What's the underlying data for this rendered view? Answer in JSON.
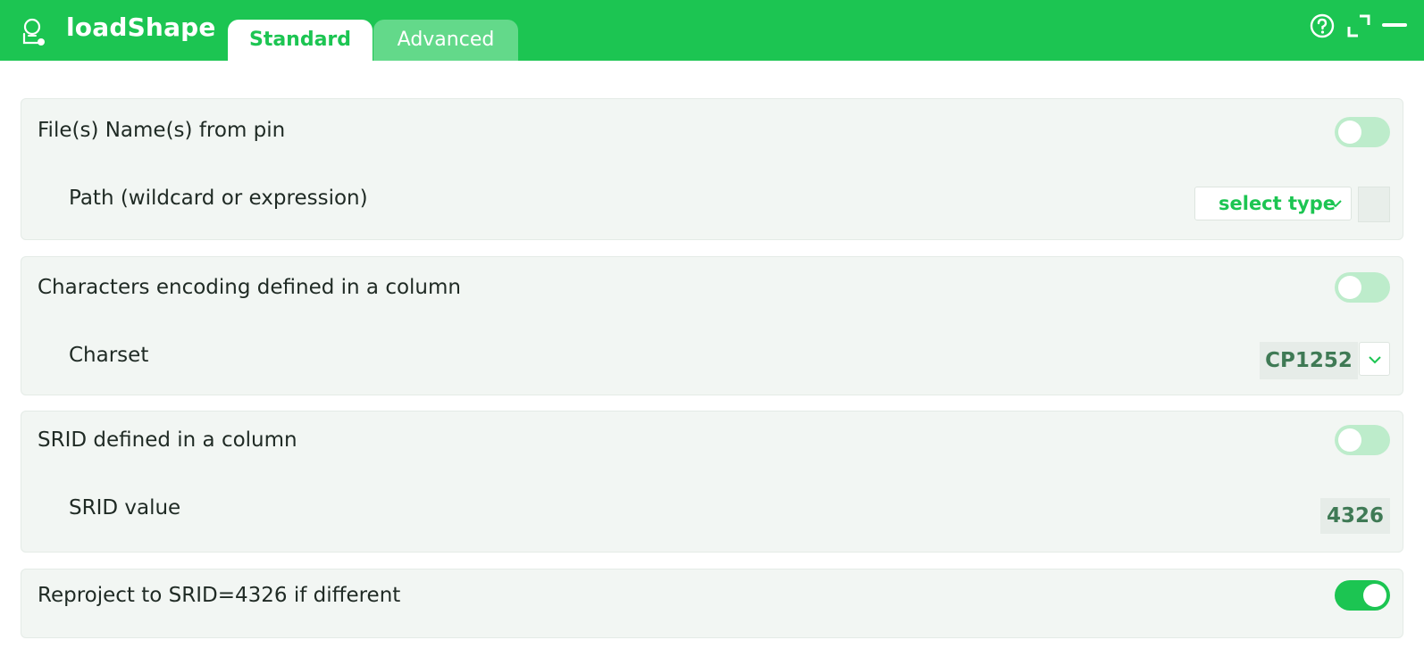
{
  "app": {
    "title": "loadShape",
    "accent": "#1cc552"
  },
  "tabs": [
    {
      "label": "Standard",
      "active": true
    },
    {
      "label": "Advanced",
      "active": false
    }
  ],
  "window_controls": [
    "help-icon",
    "maximize-icon",
    "minimize-icon"
  ],
  "sections": {
    "file_names": {
      "label": "File(s) Name(s) from pin",
      "toggle_on": false,
      "path": {
        "label": "Path (wildcard or expression)",
        "type_select": "select type",
        "value": ""
      }
    },
    "encoding": {
      "label": "Characters encoding defined in a column",
      "toggle_on": false,
      "charset": {
        "label": "Charset",
        "value": "CP1252"
      }
    },
    "srid": {
      "label": "SRID defined in a column",
      "toggle_on": false,
      "srid_value": {
        "label": "SRID value",
        "value": "4326"
      }
    },
    "reproject": {
      "label": "Reproject to SRID=4326 if different",
      "toggle_on": true
    }
  }
}
